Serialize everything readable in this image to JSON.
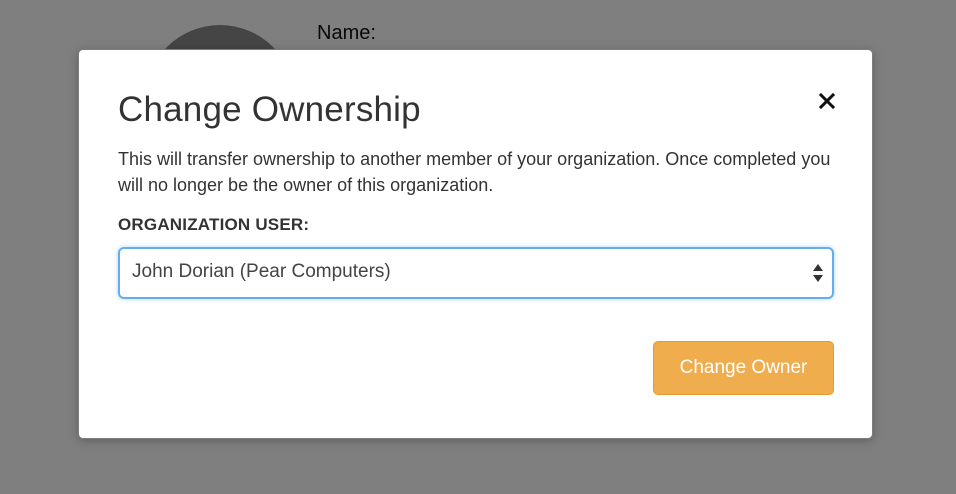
{
  "background": {
    "name_label": "Name:"
  },
  "modal": {
    "title": "Change Ownership",
    "description": "This will transfer ownership to another member of your organization. Once completed you will no longer be the owner of this organization.",
    "field_label": "ORGANIZATION USER:",
    "select": {
      "selected_value": "John Dorian (Pear Computers)"
    },
    "primary_button_label": "Change Owner",
    "close_icon": "close-icon"
  },
  "colors": {
    "primary_button": "#f0ad4e",
    "select_focus_border": "#64aef0",
    "overlay": "rgba(0,0,0,0.5)",
    "text": "#333333"
  }
}
